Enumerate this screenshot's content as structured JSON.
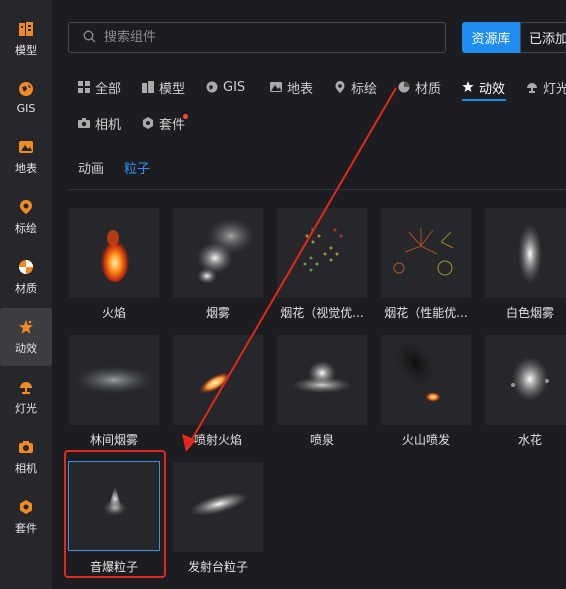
{
  "sidebar": {
    "items": [
      {
        "label": "模型",
        "icon": "model-icon"
      },
      {
        "label": "GIS",
        "icon": "gis-icon"
      },
      {
        "label": "地表",
        "icon": "terrain-icon"
      },
      {
        "label": "标绘",
        "icon": "marker-icon"
      },
      {
        "label": "材质",
        "icon": "material-icon"
      },
      {
        "label": "动效",
        "icon": "effect-icon"
      },
      {
        "label": "灯光",
        "icon": "light-icon"
      },
      {
        "label": "相机",
        "icon": "camera-icon"
      },
      {
        "label": "套件",
        "icon": "kit-icon"
      }
    ],
    "active": "动效"
  },
  "search": {
    "placeholder": "搜索组件"
  },
  "top_tabs": {
    "library": "资源库",
    "added": "已添加"
  },
  "categories": [
    {
      "label": "全部",
      "icon": "grid-icon"
    },
    {
      "label": "模型",
      "icon": "building-icon"
    },
    {
      "label": "GIS",
      "icon": "globe-icon"
    },
    {
      "label": "地表",
      "icon": "terrain-icon"
    },
    {
      "label": "标绘",
      "icon": "pin-icon"
    },
    {
      "label": "材质",
      "icon": "material-ball-icon"
    },
    {
      "label": "动效",
      "icon": "star-icon"
    },
    {
      "label": "灯光",
      "icon": "lamp-icon"
    },
    {
      "label": "相机",
      "icon": "camera-icon"
    },
    {
      "label": "套件",
      "icon": "kit-icon"
    }
  ],
  "active_category": "动效",
  "subtabs": [
    {
      "label": "动画"
    },
    {
      "label": "粒子"
    }
  ],
  "active_subtab": "粒子",
  "items": [
    {
      "label": "火焰",
      "icon": "fire-thumbnail"
    },
    {
      "label": "烟雾",
      "icon": "smoke-thumbnail"
    },
    {
      "label": "烟花（视觉优...",
      "icon": "firework-thumbnail"
    },
    {
      "label": "烟花（性能优...",
      "icon": "firework-thumbnail"
    },
    {
      "label": "白色烟雾",
      "icon": "white-smoke-thumbnail"
    },
    {
      "label": "林间烟雾",
      "icon": "forest-fog-thumbnail"
    },
    {
      "label": "喷射火焰",
      "icon": "jet-flame-thumbnail"
    },
    {
      "label": "喷泉",
      "icon": "fountain-thumbnail"
    },
    {
      "label": "火山喷发",
      "icon": "volcano-thumbnail"
    },
    {
      "label": "水花",
      "icon": "splash-thumbnail"
    },
    {
      "label": "音爆粒子",
      "icon": "sonic-boom-thumbnail"
    },
    {
      "label": "发射台粒子",
      "icon": "launchpad-thumbnail"
    }
  ],
  "selected_item": "音爆粒子",
  "colors": {
    "accent": "#1f8cf0",
    "highlight_box": "#e0281f",
    "background": "#1c1d20"
  }
}
